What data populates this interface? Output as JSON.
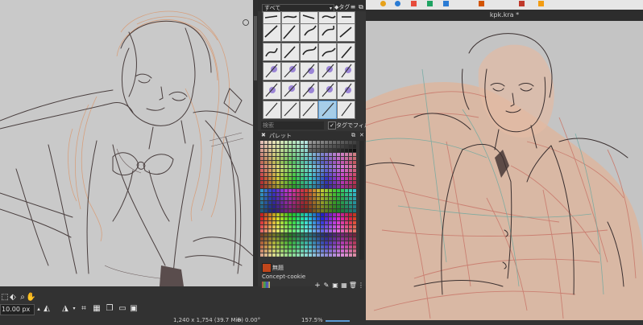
{
  "brush_presets": {
    "filter_selected": "すべて",
    "tag_label": "タグ",
    "search_placeholder": "検索",
    "tag_filter_label": "タグでフィルタ"
  },
  "palette": {
    "title": "パレット",
    "fg_color_name": "無題",
    "palette_name": "Concept-cookie"
  },
  "toolbar": {
    "brush_size": "10.00 px"
  },
  "status_bar": {
    "image_size": "1,240 x 1,754 (39.7 MiB)",
    "rotation": "0.00°",
    "zoom": "157.5%"
  },
  "right_window": {
    "title": "kpk.kra *"
  },
  "colors": {
    "accent": "#5b9bd5",
    "foreground": "#c0461b"
  }
}
